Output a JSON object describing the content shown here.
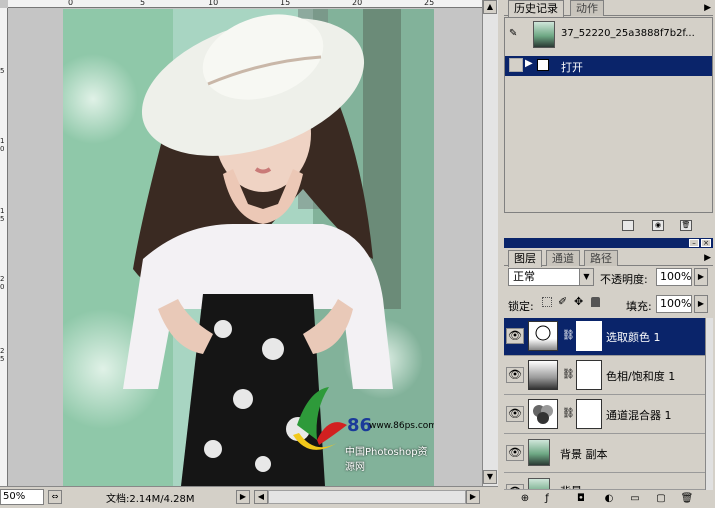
{
  "canvas": {
    "ruler_top_ticks": [
      "0",
      "5",
      "10",
      "15",
      "20",
      "25"
    ],
    "ruler_left_ticks": [
      "5",
      "1",
      "0",
      "1",
      "5",
      "2",
      "0",
      "2",
      "5"
    ],
    "watermark_site": "www.86ps.com",
    "watermark_logo": "86",
    "watermark_text": "中国Photoshop资源网"
  },
  "status_bar": {
    "zoom": "50%",
    "doc_info": "文档:2.14M/4.28M"
  },
  "history_panel": {
    "tabs": [
      {
        "label": "历史记录",
        "active": true
      },
      {
        "label": "动作",
        "active": false
      }
    ],
    "snapshot_name": "37_52220_25a3888f7b2f...",
    "items": [
      {
        "label": "打开",
        "selected": true
      }
    ]
  },
  "layers_panel": {
    "tabs": [
      {
        "label": "图层",
        "active": true
      },
      {
        "label": "通道",
        "active": false
      },
      {
        "label": "路径",
        "active": false
      }
    ],
    "blend_mode": "正常",
    "opacity_label": "不透明度:",
    "opacity_value": "100%",
    "lock_label": "锁定:",
    "fill_label": "填充:",
    "fill_value": "100%",
    "layers": [
      {
        "name": "选取颜色 1",
        "type": "adjustment-selective-color",
        "selected": true,
        "visible": true
      },
      {
        "name": "色相/饱和度 1",
        "type": "adjustment-hue-saturation",
        "selected": false,
        "visible": true
      },
      {
        "name": "通道混合器 1",
        "type": "adjustment-channel-mixer",
        "selected": false,
        "visible": true
      },
      {
        "name": "背景 副本",
        "type": "pixel",
        "selected": false,
        "visible": true
      },
      {
        "name": "背景",
        "type": "pixel",
        "selected": false,
        "visible": true
      }
    ]
  },
  "colors": {
    "selection": "#0a246a",
    "panel_bg": "#d4d0c8"
  }
}
